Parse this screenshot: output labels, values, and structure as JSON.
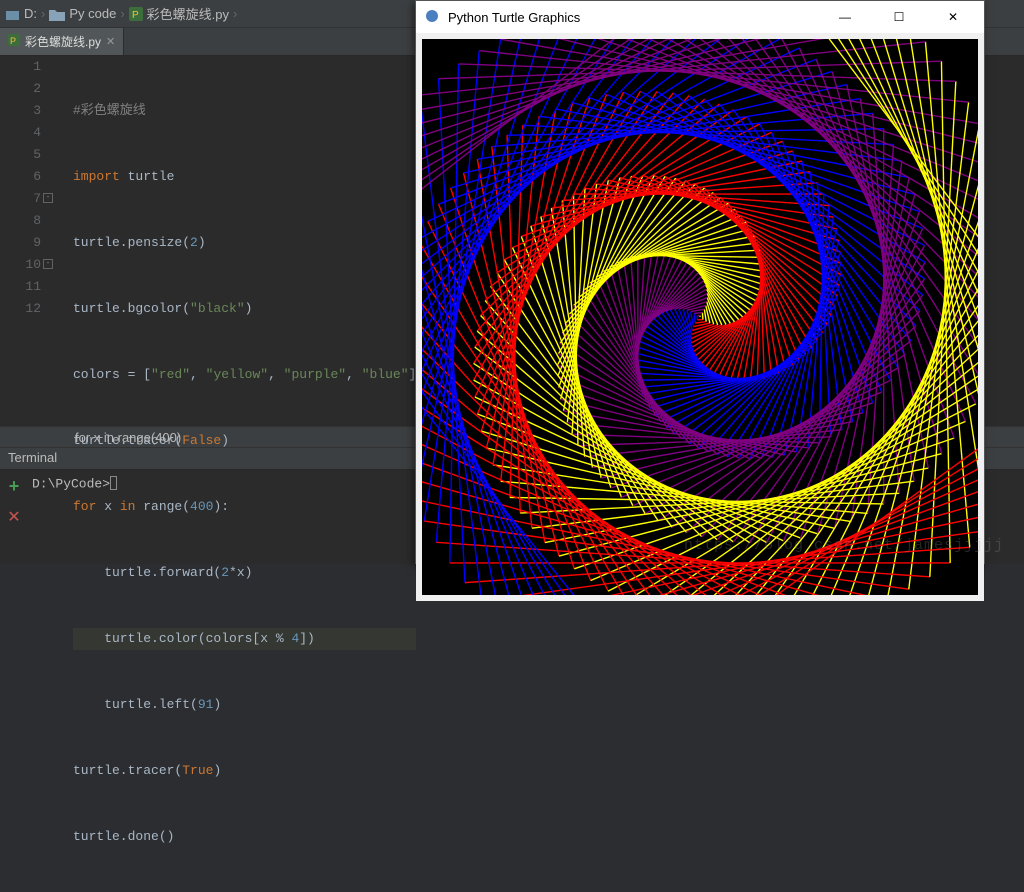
{
  "breadcrumb": {
    "drive": "D:",
    "folder": "Py code",
    "file": "彩色螺旋线.py"
  },
  "tab": {
    "label": "彩色螺旋线.py"
  },
  "gutter_lines": [
    "1",
    "2",
    "3",
    "4",
    "5",
    "6",
    "7",
    "8",
    "9",
    "10",
    "11",
    "12"
  ],
  "code": {
    "l1_comment": "#彩色螺旋线",
    "l2_kw": "import",
    "l2_mod": " turtle",
    "l3": "turtle.pensize(",
    "l3_num": "2",
    "l3_end": ")",
    "l4": "turtle.bgcolor(",
    "l4_str": "\"black\"",
    "l4_end": ")",
    "l5_pre": "colors = [",
    "l5_s1": "\"red\"",
    "l5_s2": "\"yellow\"",
    "l5_s3": "\"purple\"",
    "l5_s4": "\"blue\"",
    "l5_end": "]",
    "l6": "turtle.tracer(",
    "l6_kw": "False",
    "l6_end": ")",
    "l7_kw1": "for",
    "l7_var": " x ",
    "l7_kw2": "in",
    "l7_rest": " range(",
    "l7_num": "400",
    "l7_end": "):",
    "l8": "    turtle.forward(",
    "l8_num": "2",
    "l8_rest": "*x)",
    "l9": "    turtle.color(colors[x % ",
    "l9_num": "4",
    "l9_end": "])",
    "l10": "    turtle.left(",
    "l10_num": "91",
    "l10_end": ")",
    "l11": "turtle.tracer(",
    "l11_kw": "True",
    "l11_end": ")",
    "l12": "turtle.done()"
  },
  "editor_status": "for x in range(400)",
  "terminal": {
    "header": "Terminal",
    "prompt": "D:\\PyCode>"
  },
  "turtle_window": {
    "title": "Python Turtle Graphics"
  },
  "watermark": "https://blog.csdn.net/jamesjjjjj",
  "chart_data": {
    "type": "line",
    "title": "Python Turtle Graphics",
    "description": "Colored spiral drawn by turtle: for x in 0..399, forward(2*x), left(91°), stroke color = colors[x % 4]",
    "colors": [
      "red",
      "yellow",
      "purple",
      "blue"
    ],
    "pensize": 2,
    "bgcolor": "black",
    "iterations": 400,
    "step_length_formula": "2*x",
    "turn_angle_deg": 91
  }
}
